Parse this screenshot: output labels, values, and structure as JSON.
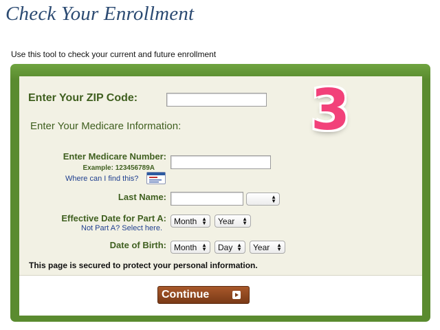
{
  "header": {
    "title": "Check Your Enrollment",
    "intro": "Use this tool to check your current and future enrollment"
  },
  "form": {
    "zip_label": "Enter Your ZIP Code:",
    "zip_value": "",
    "medicare_info_heading": "Enter Your Medicare Information:",
    "medicare_number_label": "Enter Medicare Number:",
    "medicare_number_example": "Example: 123456789A",
    "medicare_number_value": "",
    "where_find_link": "Where can I find this?",
    "last_name_label": "Last Name:",
    "last_name_value": "",
    "suffix_select_value": "",
    "effective_date_label": "Effective Date for Part A:",
    "not_part_a_link": "Not Part A? Select here.",
    "effective_month": "Month",
    "effective_year": "Year",
    "dob_label": "Date of Birth:",
    "dob_month": "Month",
    "dob_day": "Day",
    "dob_year": "Year",
    "secure_note": "This page is secured to protect your personal information."
  },
  "overlay": {
    "step_number": "3"
  },
  "actions": {
    "continue_label": "Continue"
  },
  "colors": {
    "title": "#2b4a72",
    "frame_green": "#5c8f33",
    "label_green": "#3f5f1f",
    "panel": "#f2f1e4",
    "step_pink": "#f2417a",
    "button_brown": "#8a4520"
  }
}
